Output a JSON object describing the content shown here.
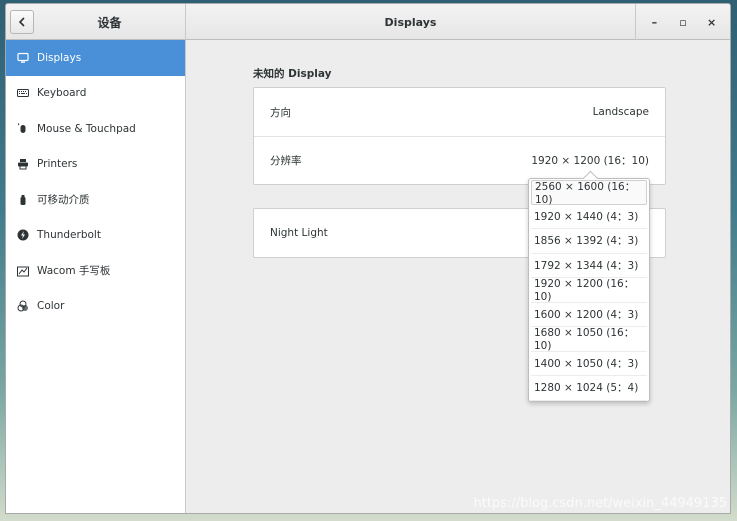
{
  "titlebar": {
    "left_title": "设备",
    "title": "Displays",
    "minimize_label": "–",
    "maximize_label": "▫",
    "close_label": "×"
  },
  "sidebar": {
    "items": [
      {
        "label": "Displays",
        "icon": "display-icon",
        "active": true
      },
      {
        "label": "Keyboard",
        "icon": "keyboard-icon"
      },
      {
        "label": "Mouse & Touchpad",
        "icon": "mouse-icon"
      },
      {
        "label": "Printers",
        "icon": "printer-icon"
      },
      {
        "label": "可移动介质",
        "icon": "removable-media-icon"
      },
      {
        "label": "Thunderbolt",
        "icon": "thunderbolt-icon"
      },
      {
        "label": "Wacom 手写板",
        "icon": "wacom-tablet-icon"
      },
      {
        "label": "Color",
        "icon": "color-icon"
      }
    ]
  },
  "main": {
    "section_title": "未知的  Display",
    "orientation_label": "方向",
    "orientation_value": "Landscape",
    "resolution_label": "分辨率",
    "resolution_value": "1920 × 1200 (16：10)",
    "night_light_label": "Night Light"
  },
  "resolution_options": [
    "2560 × 1600 (16：10)",
    "1920 × 1440 (4：3)",
    "1856 × 1392 (4：3)",
    "1792 × 1344 (4：3)",
    "1920 × 1200 (16：10)",
    "1600 × 1200 (4：3)",
    "1680 × 1050 (16：10)",
    "1400 × 1050 (4：3)",
    "1280 × 1024 (5：4)"
  ],
  "watermark": "https://blog.csdn.net/weixin_44949135",
  "colors": {
    "accent": "#4a90d9"
  }
}
